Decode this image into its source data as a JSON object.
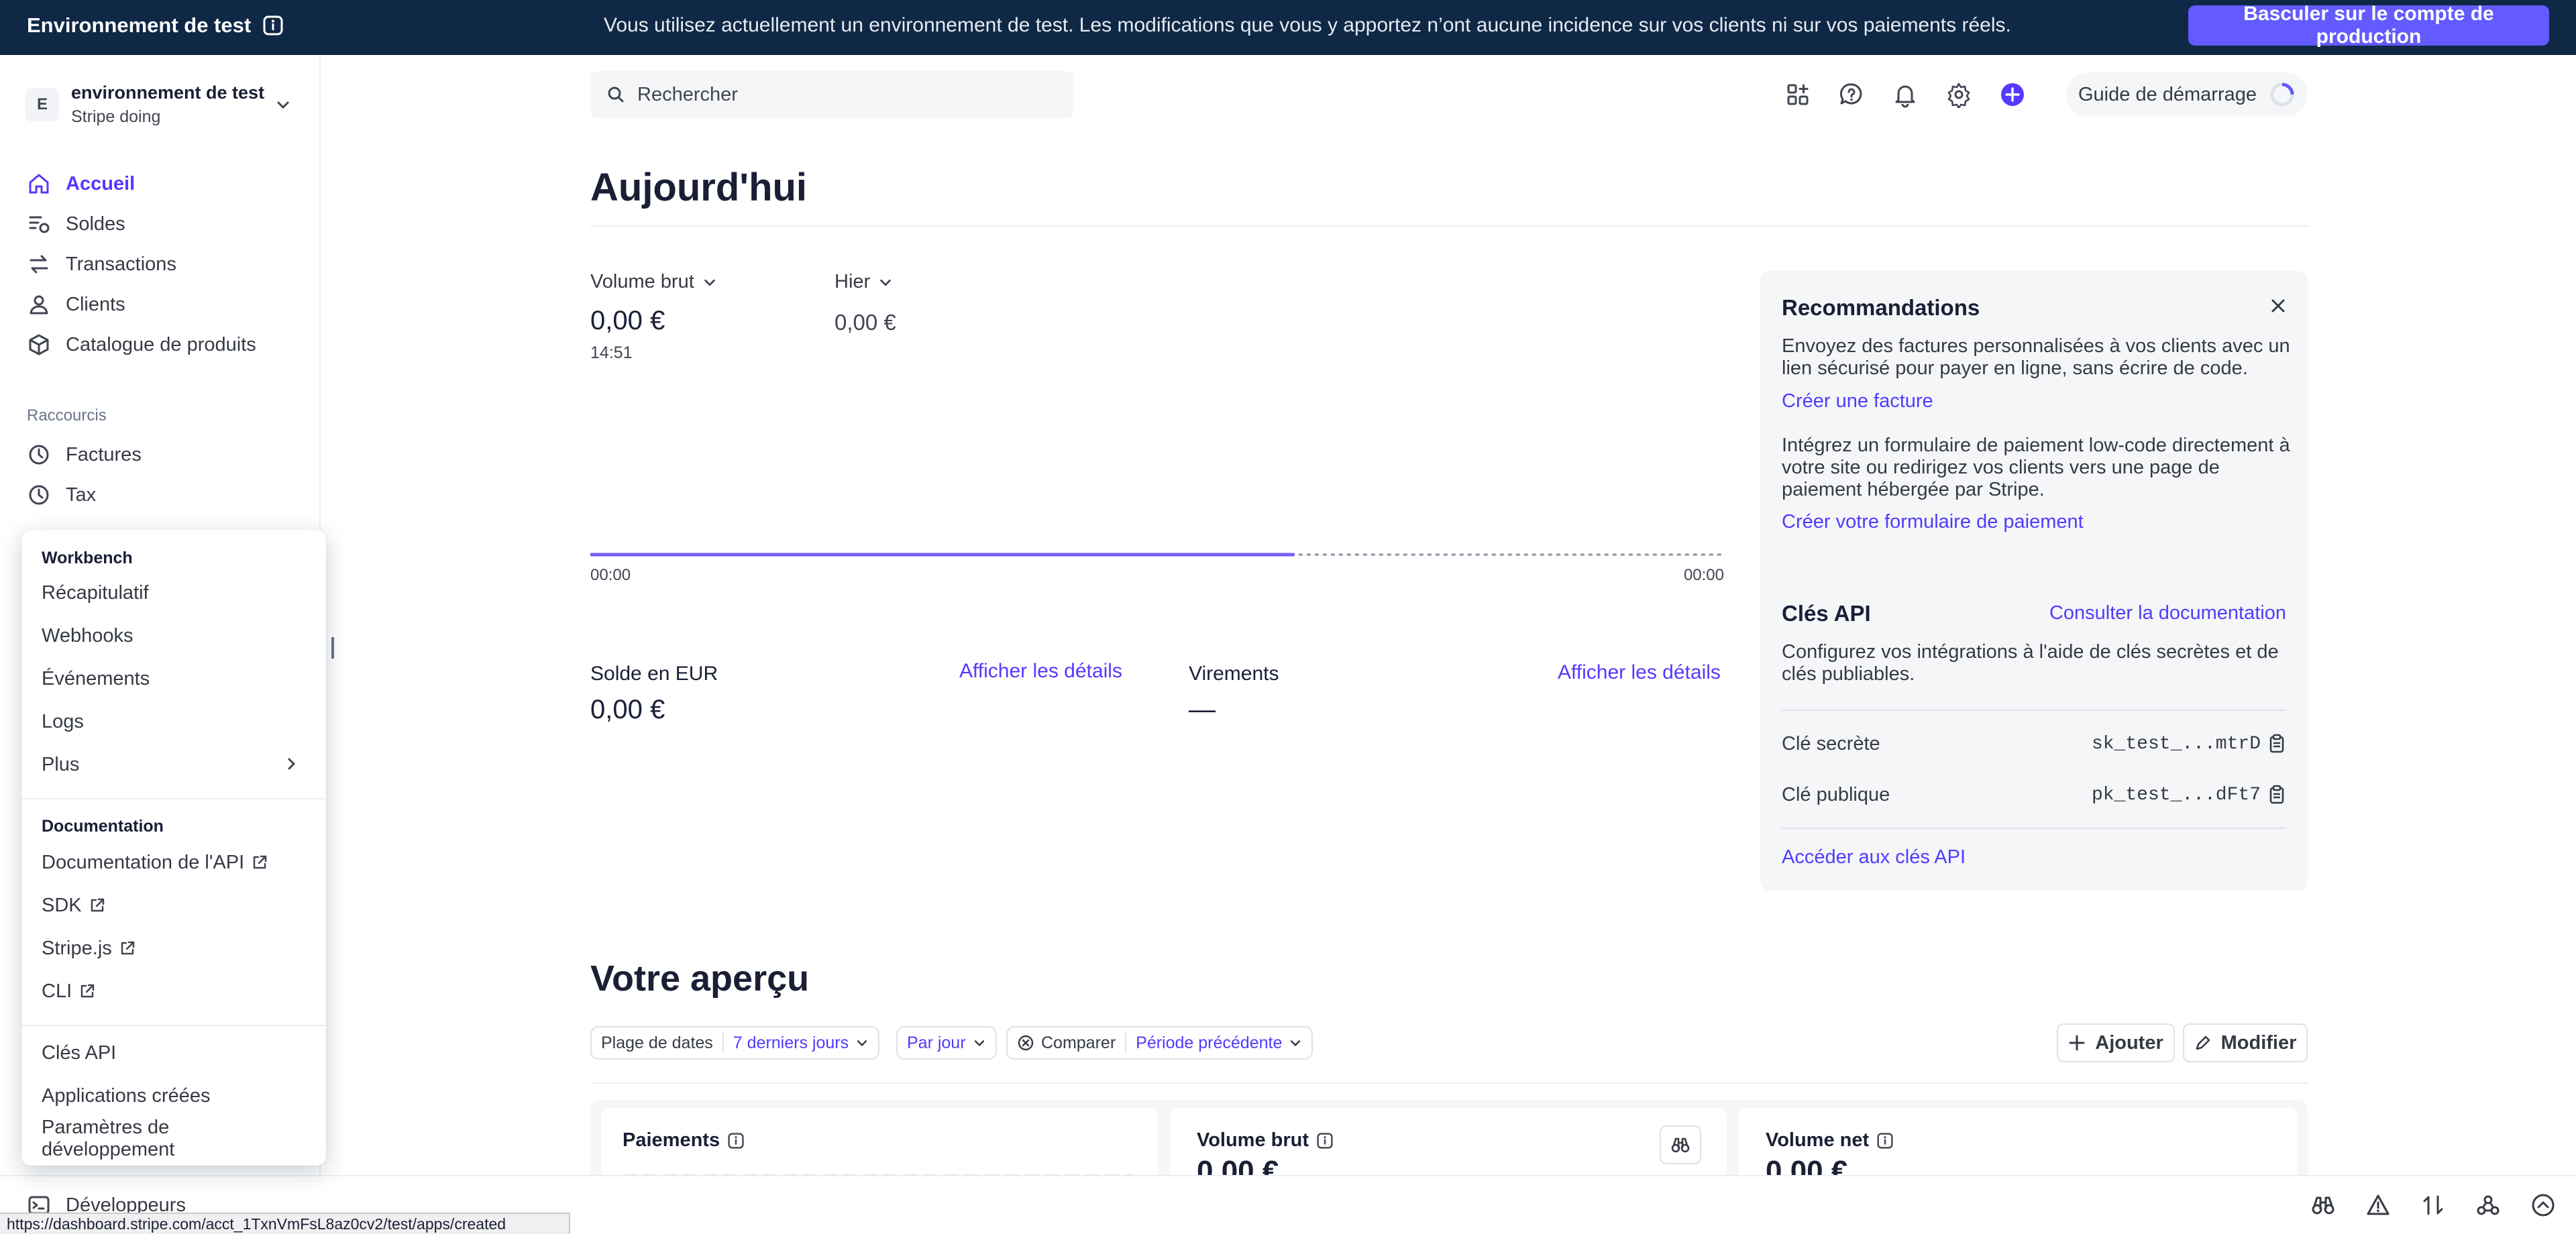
{
  "banner": {
    "env_title": "Environnement de test",
    "message": "Vous utilisez actuellement un environnement de test. Les modifications que vous y apportez n’ont aucune incidence sur vos clients ni sur vos paiements réels.",
    "prod_button": "Basculer sur le compte de production"
  },
  "account": {
    "initial": "E",
    "name": "environnement de test...",
    "sub": "Stripe doing"
  },
  "nav": {
    "items": [
      {
        "label": "Accueil",
        "icon": "home-icon"
      },
      {
        "label": "Soldes",
        "icon": "balances-icon"
      },
      {
        "label": "Transactions",
        "icon": "transactions-icon"
      },
      {
        "label": "Clients",
        "icon": "person-icon"
      },
      {
        "label": "Catalogue de produits",
        "icon": "box-icon"
      }
    ],
    "shortcuts_title": "Raccourcis",
    "shortcuts": [
      {
        "label": "Factures",
        "icon": "clock-icon"
      },
      {
        "label": "Tax",
        "icon": "clock-icon"
      }
    ],
    "bottom_item": "Développeurs"
  },
  "dev_menu": {
    "workbench_title": "Workbench",
    "workbench_items": [
      "Récapitulatif",
      "Webhooks",
      "Événements",
      "Logs",
      "Plus"
    ],
    "docs_title": "Documentation",
    "docs_items": [
      "Documentation de l'API",
      "SDK",
      "Stripe.js",
      "CLI"
    ],
    "other_items": [
      "Clés API",
      "Applications créées",
      "Paramètres de développement"
    ]
  },
  "header": {
    "search_placeholder": "Rechercher",
    "guide_label": "Guide de démarrage"
  },
  "today": {
    "title": "Aujourd'hui",
    "metric_label": "Volume brut",
    "metric_value": "0,00 €",
    "metric_time": "14:51",
    "compare_label": "Hier",
    "compare_value": "0,00 €",
    "axis_start": "00:00",
    "axis_end": "00:00",
    "progress_fraction": 0.62
  },
  "balances": {
    "eur_label": "Solde en EUR",
    "eur_value": "0,00 €",
    "eur_link": "Afficher les détails",
    "payouts_label": "Virements",
    "payouts_value": "—",
    "payouts_link": "Afficher les détails"
  },
  "reco": {
    "title": "Recommandations",
    "text1": "Envoyez des factures personnalisées à vos clients avec un lien sécurisé pour payer en ligne, sans écrire de code.",
    "link1": "Créer une facture",
    "text2": "Intégrez un formulaire de paiement low-code directement à votre site ou redirigez vos clients vers une page de paiement hébergée par Stripe.",
    "link2": "Créer votre formulaire de paiement",
    "api_title": "Clés API",
    "api_doc_link": "Consulter la documentation",
    "api_text": "Configurez vos intégrations à l'aide de clés secrètes et de clés publiables.",
    "secret_label": "Clé secrète",
    "secret_value": "sk_test_...mtrD",
    "public_label": "Clé publique",
    "public_value": "pk_test_...dFt7",
    "api_keys_link": "Accéder aux clés API"
  },
  "overview": {
    "title": "Votre aperçu",
    "date_range_label": "Plage de dates",
    "date_range_value": "7 derniers jours",
    "granularity": "Par jour",
    "compare_label": "Comparer",
    "compare_value": "Période précédente",
    "add_button": "Ajouter",
    "edit_button": "Modifier",
    "cards": [
      {
        "title": "Paiements",
        "value": ""
      },
      {
        "title": "Volume brut",
        "value": "0,00 €"
      },
      {
        "title": "Volume net",
        "value": "0,00 €"
      }
    ]
  },
  "status_url": "https://dashboard.stripe.com/acct_1TxnVmFsL8az0cv2/test/apps/created",
  "colors": {
    "accent": "#635bff",
    "link": "#533afd",
    "banner_bg": "#0f2846"
  }
}
